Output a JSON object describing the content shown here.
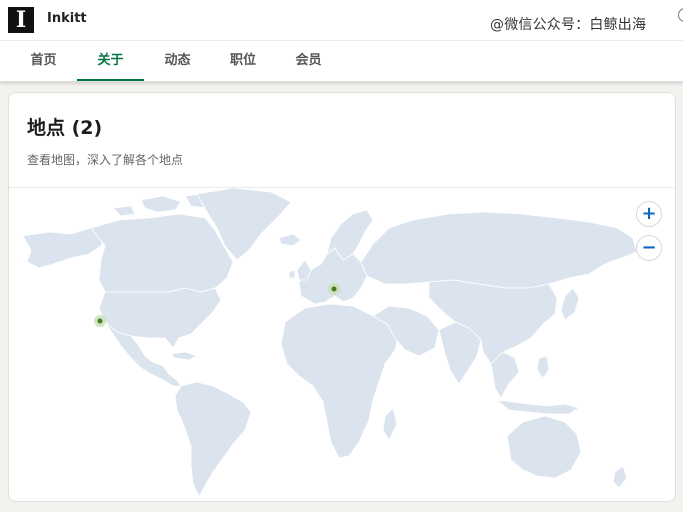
{
  "header": {
    "logo_letter": "I",
    "company_name": "Inkitt",
    "watermark": "@微信公众号：白鲸出海"
  },
  "tabs": [
    {
      "label": "首页",
      "active": false
    },
    {
      "label": "关于",
      "active": true
    },
    {
      "label": "动态",
      "active": false
    },
    {
      "label": "职位",
      "active": false
    },
    {
      "label": "会员",
      "active": false
    }
  ],
  "locations_card": {
    "title": "地点 (2)",
    "subtitle": "查看地图，深入了解各个地点",
    "zoom_in_label": "+",
    "zoom_out_label": "−",
    "markers": [
      {
        "region": "west-coast-usa"
      },
      {
        "region": "central-europe"
      }
    ]
  },
  "colors": {
    "accent_green": "#057642",
    "link_blue": "#0a66c2",
    "land": "#dbe4ee",
    "marker": "#4a7a2b"
  }
}
